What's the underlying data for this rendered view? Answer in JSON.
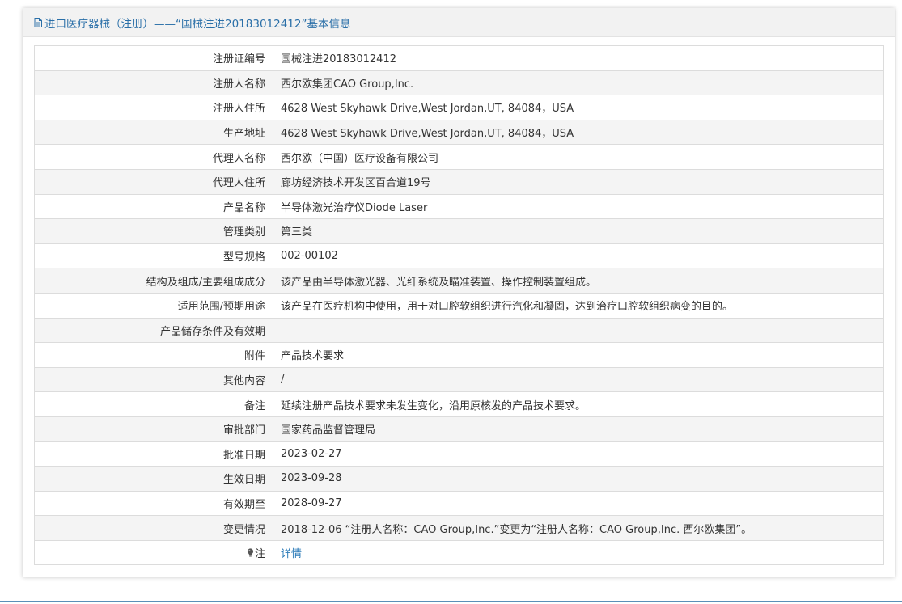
{
  "header": {
    "title": "进口医疗器械（注册）——“国械注进20183012412”基本信息",
    "icon": "document-icon"
  },
  "rows": [
    {
      "label": "注册证编号",
      "value": "国械注进20183012412"
    },
    {
      "label": "注册人名称",
      "value": "西尔欧集团CAO Group,Inc."
    },
    {
      "label": "注册人住所",
      "value": "4628 West Skyhawk Drive,West Jordan,UT, 84084，USA"
    },
    {
      "label": "生产地址",
      "value": "4628 West Skyhawk Drive,West Jordan,UT, 84084，USA"
    },
    {
      "label": "代理人名称",
      "value": "西尔欧（中国）医疗设备有限公司"
    },
    {
      "label": "代理人住所",
      "value": "廊坊经济技术开发区百合道19号"
    },
    {
      "label": "产品名称",
      "value": "半导体激光治疗仪Diode Laser"
    },
    {
      "label": "管理类别",
      "value": "第三类"
    },
    {
      "label": "型号规格",
      "value": "002-00102"
    },
    {
      "label": "结构及组成/主要组成成分",
      "value": "该产品由半导体激光器、光纤系统及瞄准装置、操作控制装置组成。"
    },
    {
      "label": "适用范围/预期用途",
      "value": "该产品在医疗机构中使用，用于对口腔软组织进行汽化和凝固，达到治疗口腔软组织病变的目的。"
    },
    {
      "label": "产品储存条件及有效期",
      "value": ""
    },
    {
      "label": "附件",
      "value": "产品技术要求"
    },
    {
      "label": "其他内容",
      "value": "/"
    },
    {
      "label": "备注",
      "value": "延续注册产品技术要求未发生变化，沿用原核发的产品技术要求。"
    },
    {
      "label": "审批部门",
      "value": "国家药品监督管理局"
    },
    {
      "label": "批准日期",
      "value": "2023-02-27"
    },
    {
      "label": "生效日期",
      "value": "2023-09-28"
    },
    {
      "label": "有效期至",
      "value": "2028-09-27"
    },
    {
      "label": "变更情况",
      "value": "2018-12-06 “注册人名称：CAO Group,Inc.”变更为“注册人名称：CAO Group,Inc. 西尔欧集团”。"
    }
  ],
  "note": {
    "label": "注",
    "icon": "lightbulb-icon",
    "link": "详情"
  },
  "colors": {
    "accent": "#2a6fa8",
    "link": "#2a7ab8",
    "border": "#dcdcdc",
    "stripe": "#f4f4f4"
  }
}
